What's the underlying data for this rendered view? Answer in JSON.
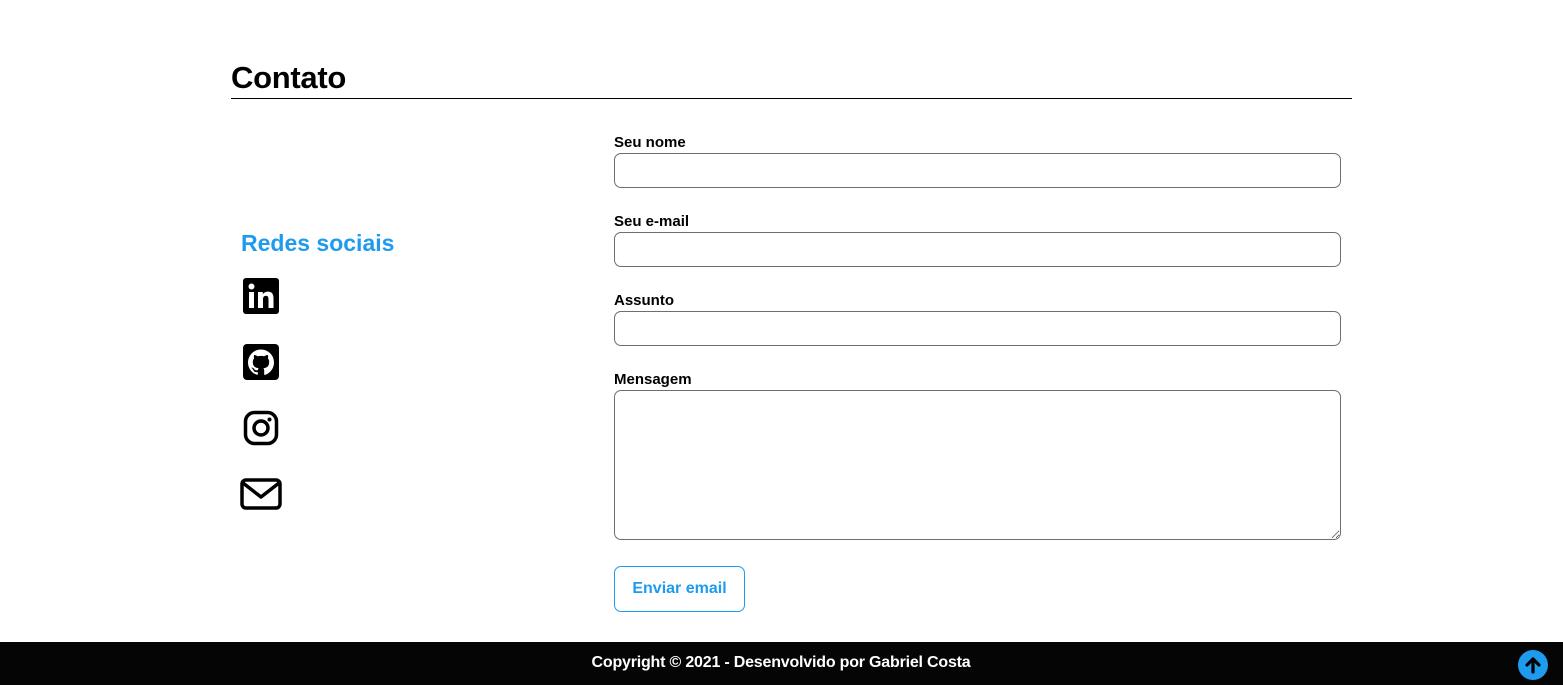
{
  "colors": {
    "accent": "#1e9bef",
    "footer_bg": "#050505",
    "text": "#000000"
  },
  "section": {
    "title": "Contato"
  },
  "social": {
    "heading": "Redes sociais",
    "links": [
      {
        "icon": "linkedin-icon"
      },
      {
        "icon": "github-icon"
      },
      {
        "icon": "instagram-icon"
      },
      {
        "icon": "mail-icon"
      }
    ]
  },
  "form": {
    "name_label": "Seu nome",
    "name_value": "",
    "email_label": "Seu e-mail",
    "email_value": "",
    "subject_label": "Assunto",
    "subject_value": "",
    "message_label": "Mensagem",
    "message_value": "",
    "submit_label": "Enviar email"
  },
  "footer": {
    "copyright": "Copyright © 2021 - Desenvolvido por Gabriel Costa",
    "back_to_top_icon": "arrow-up-circle-icon"
  }
}
